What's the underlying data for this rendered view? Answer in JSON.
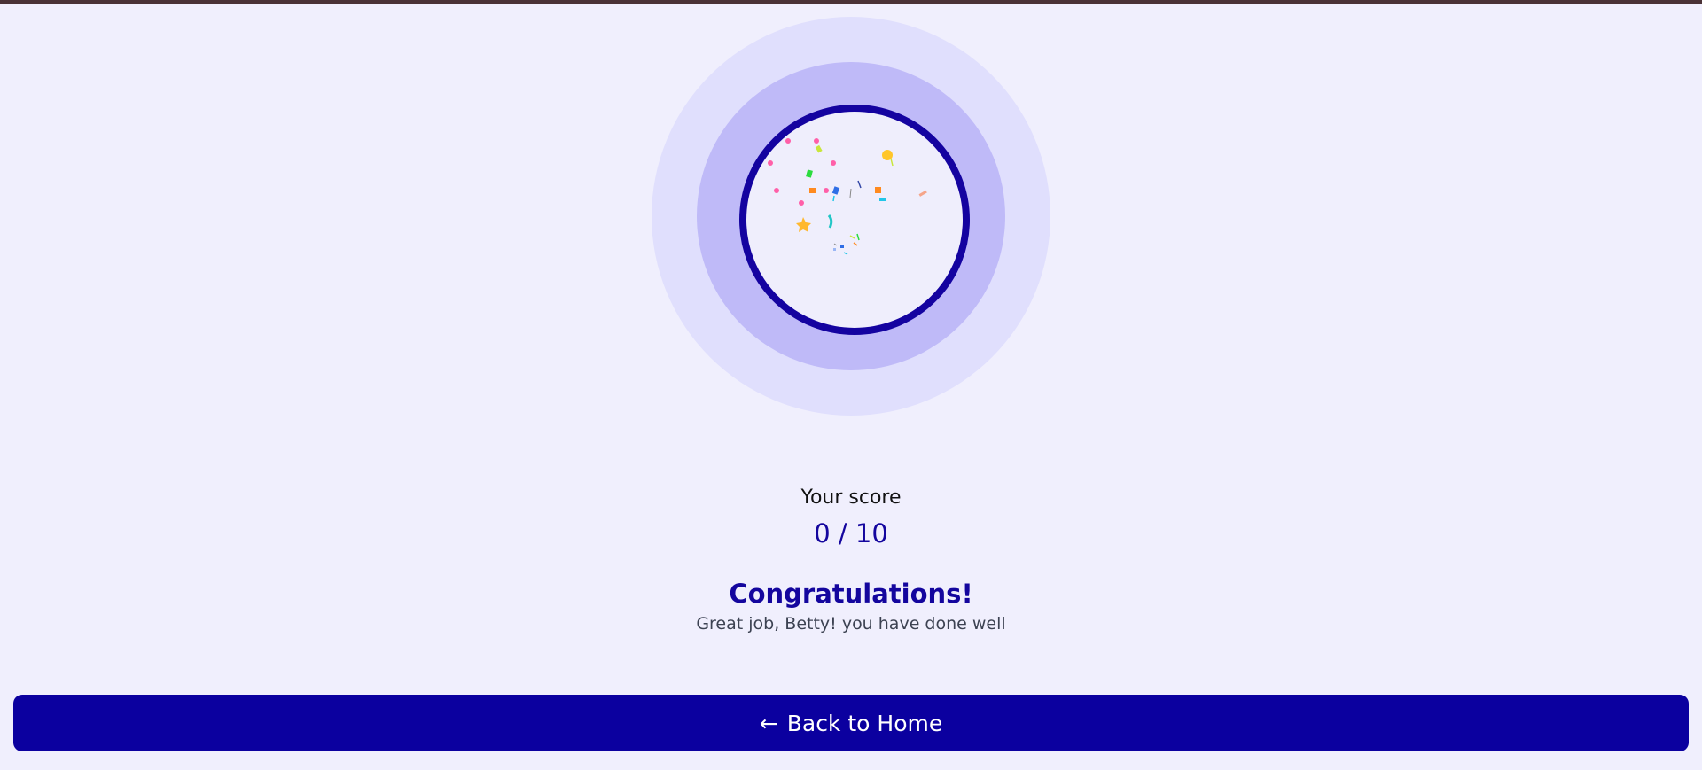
{
  "score": {
    "label": "Your score",
    "value": "0 / 10"
  },
  "result": {
    "title": "Congratulations!",
    "message": "Great job, Betty! you have done well"
  },
  "actions": {
    "back_arrow": "←",
    "back_label": "Back to Home"
  },
  "colors": {
    "background": "#f0effd",
    "accent": "#14069e",
    "button": "#0b009f",
    "ring_outer": "#e0dffd",
    "ring_middle": "#bfbaf8",
    "top_bar": "#4a3236"
  },
  "icons": {
    "celebration": "confetti-icon",
    "back": "arrow-left-icon"
  }
}
